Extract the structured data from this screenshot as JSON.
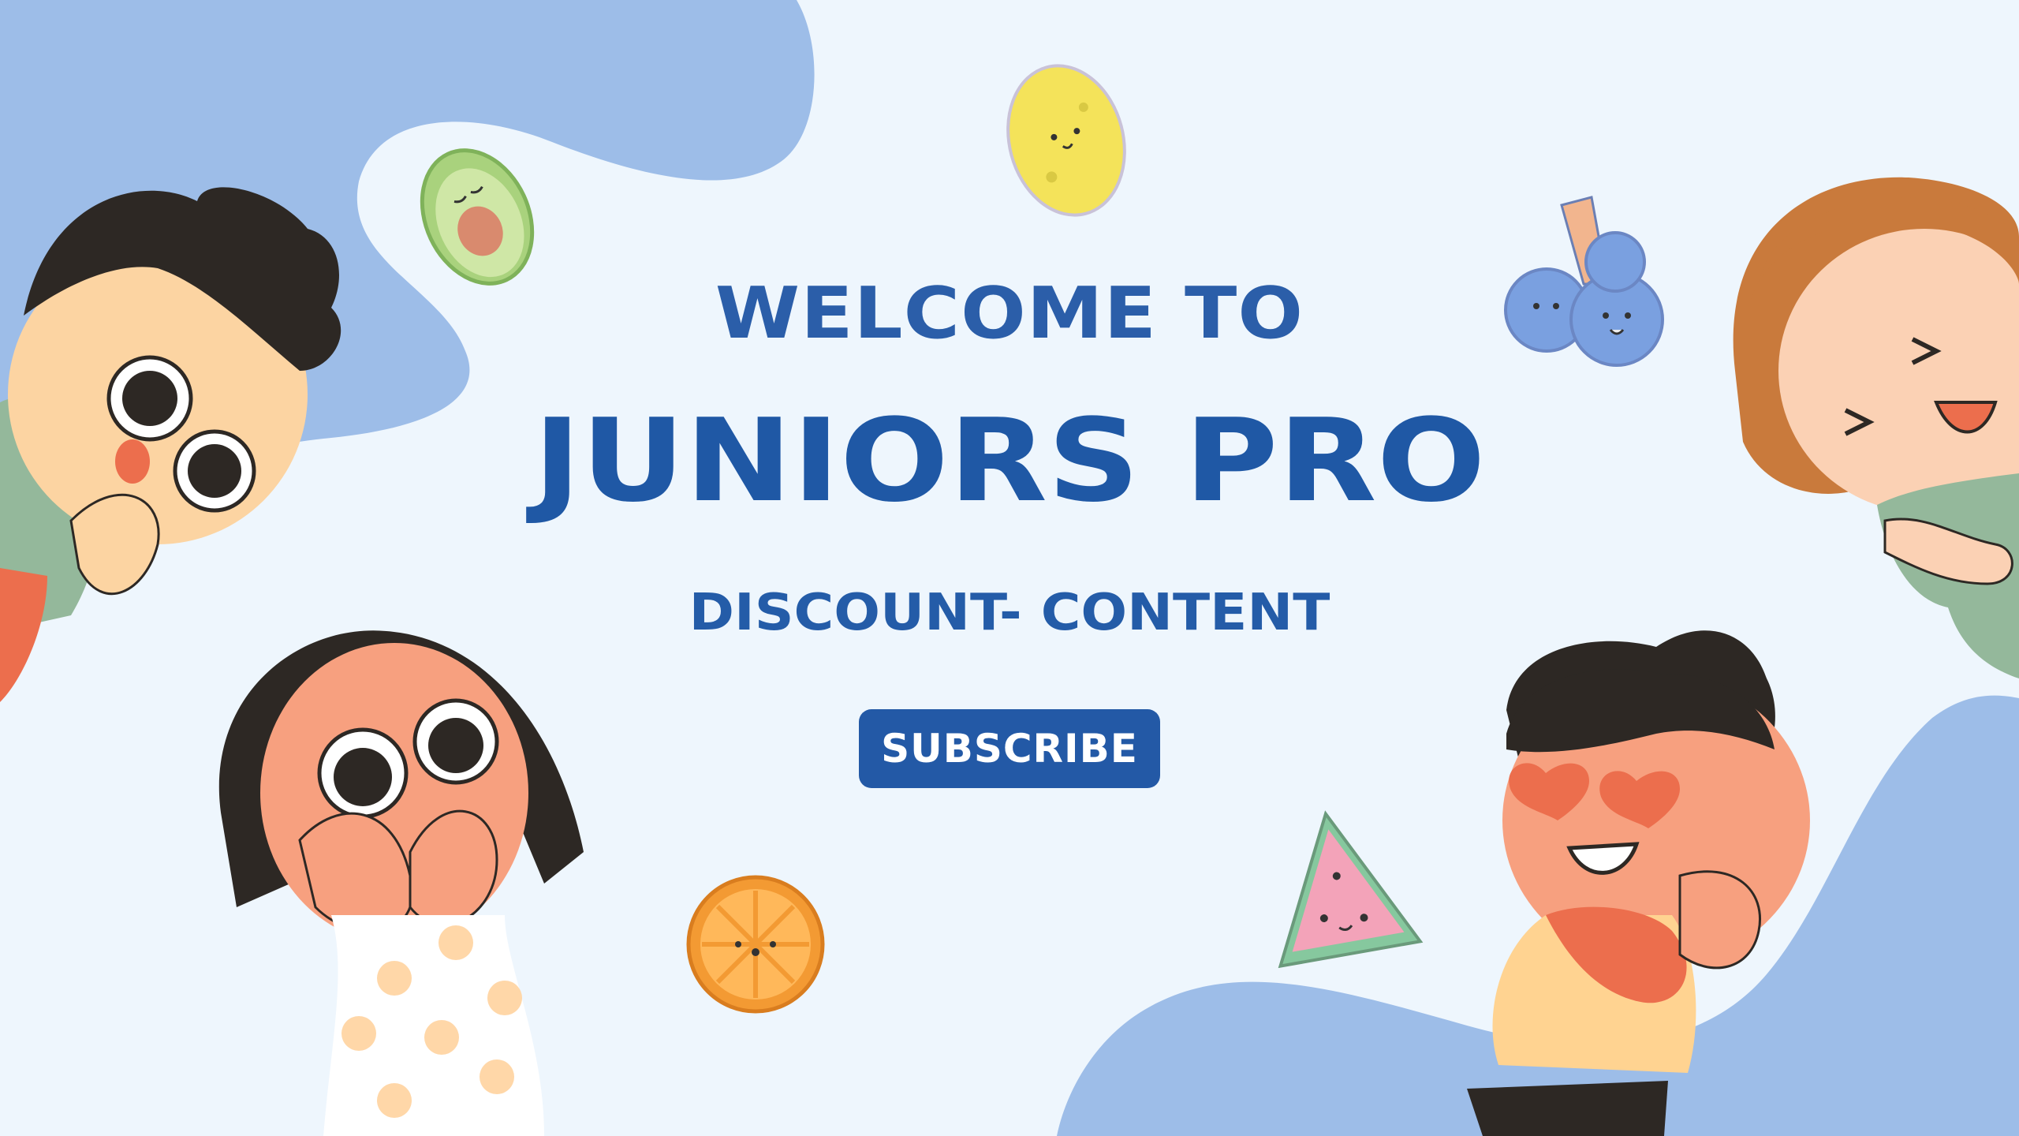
{
  "hero": {
    "line1": "WELCOME TO",
    "line2": "JUNIORS PRO",
    "line3": "DISCOUNT- CONTENT"
  },
  "cta": {
    "label": "SUBSCRIBE"
  },
  "colors": {
    "background": "#eef6fd",
    "blob": "#9dbde8",
    "text_primary": "#2358a7",
    "button": "#2359a6",
    "button_text": "#ffffff",
    "skin": "#f7a07f",
    "hair_dark": "#2d2824",
    "hair_orange": "#c97a3c",
    "shirt_green": "#94b89b",
    "shirt_yellow": "#ffd391"
  },
  "decorations": {
    "fruits": [
      "avocado-icon",
      "lemon-icon",
      "blueberries-icon",
      "orange-slice-icon",
      "watermelon-slice-icon"
    ],
    "characters": [
      "boy-top-left",
      "girl-bottom-left",
      "girl-top-right",
      "boy-bottom-right"
    ]
  }
}
